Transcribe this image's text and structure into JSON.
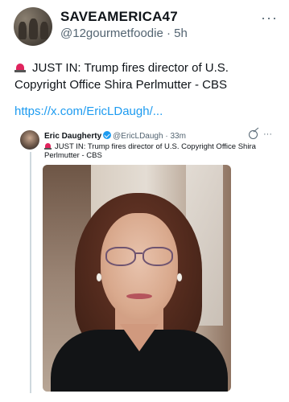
{
  "post": {
    "author_name": "SAVEAMERICA47",
    "author_handle": "@12gourmetfoodie",
    "separator": "·",
    "timestamp": "5h",
    "more_icon": "ellipsis-icon",
    "text": "JUST IN: Trump fires director of U.S. Copyright Office Shira Perlmutter - CBS",
    "emoji_icon": "police-siren-icon",
    "link_text": "https://x.com/EricLDaugh/...",
    "link_color": "#1d9bf0"
  },
  "quoted": {
    "author_name": "Eric Daugherty",
    "verified_icon": "verified-badge-icon",
    "author_handle": "@EricLDaugh",
    "separator": "·",
    "timestamp": "33m",
    "text": "JUST IN: Trump fires director of U.S. Copyright Office Shira Perlmutter - CBS",
    "grok_icon": "grok-icon",
    "more_icon": "ellipsis-icon"
  }
}
